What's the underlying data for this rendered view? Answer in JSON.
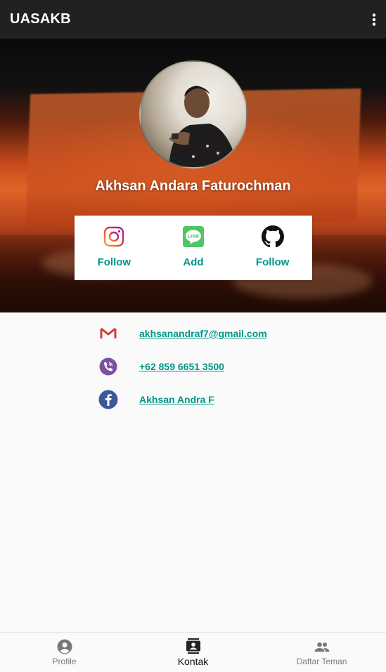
{
  "appbar": {
    "title": "UASAKB",
    "menu_icon": "more-vert-icon"
  },
  "profile": {
    "name": "Akhsan Andara Faturochman"
  },
  "social": [
    {
      "icon": "instagram-icon",
      "label": "Follow",
      "color": "#c13584"
    },
    {
      "icon": "line-icon",
      "label": "Add",
      "color": "#4cc764"
    },
    {
      "icon": "github-icon",
      "label": "Follow",
      "color": "#111111"
    }
  ],
  "contacts": [
    {
      "icon": "gmail-icon",
      "text": "akhsanandraf7@gmail.com"
    },
    {
      "icon": "viber-icon",
      "text": "+62 859 6651 3500"
    },
    {
      "icon": "facebook-icon",
      "text": "Akhsan Andra F"
    }
  ],
  "bottom_nav": [
    {
      "icon": "account-circle-icon",
      "label": "Profile",
      "active": false
    },
    {
      "icon": "contacts-icon",
      "label": "Kontak",
      "active": true
    },
    {
      "icon": "people-icon",
      "label": "Daftar Teman",
      "active": false
    }
  ],
  "colors": {
    "accent": "#009688",
    "appbar": "#212121"
  }
}
